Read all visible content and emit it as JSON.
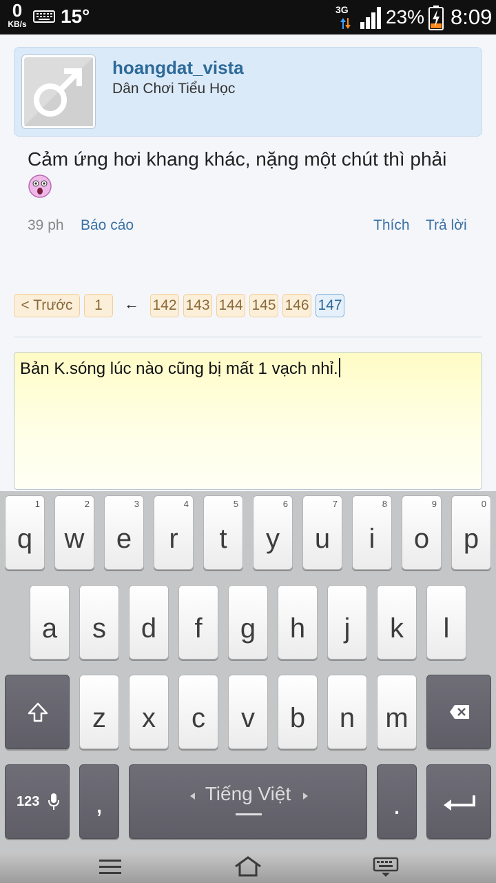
{
  "status_bar": {
    "net_speed": "0",
    "net_speed_unit": "KB/s",
    "temperature": "15°",
    "network_type": "3G",
    "battery_percent": "23%",
    "time": "8:09"
  },
  "post": {
    "username": "hoangdat_vista",
    "user_title": "Dân Chơi Tiểu Học",
    "message": "Cảm ứng hơi khang khác, nặng một chút thì phải",
    "time_ago": "39 ph",
    "report_label": "Báo cáo",
    "like_label": "Thích",
    "reply_label": "Trả lời"
  },
  "pagination": {
    "prev_label": "< Trước",
    "first": "1",
    "gap_arrow": "←",
    "pages": [
      "142",
      "143",
      "144",
      "145",
      "146",
      "147"
    ],
    "current_page": "147"
  },
  "reply_box": {
    "value": "Bản K.sóng lúc nào cũng bị mất 1 vạch nhỉ."
  },
  "keyboard": {
    "row1": [
      {
        "key": "q",
        "hint": "1"
      },
      {
        "key": "w",
        "hint": "2"
      },
      {
        "key": "e",
        "hint": "3"
      },
      {
        "key": "r",
        "hint": "4"
      },
      {
        "key": "t",
        "hint": "5"
      },
      {
        "key": "y",
        "hint": "6"
      },
      {
        "key": "u",
        "hint": "7"
      },
      {
        "key": "i",
        "hint": "8"
      },
      {
        "key": "o",
        "hint": "9"
      },
      {
        "key": "p",
        "hint": "0"
      }
    ],
    "row2": [
      "a",
      "s",
      "d",
      "f",
      "g",
      "h",
      "j",
      "k",
      "l"
    ],
    "row3": [
      "z",
      "x",
      "c",
      "v",
      "b",
      "n",
      "m"
    ],
    "mode_label": "123",
    "comma": ",",
    "period": ".",
    "space_label": "Tiếng Việt"
  },
  "colors": {
    "accent": "#2d6a99",
    "card_bg": "#dbeaf8",
    "page_button_bg": "#fbefd9",
    "reply_bg": "#fffcc6",
    "keyboard_bg": "#c4c6c7"
  }
}
